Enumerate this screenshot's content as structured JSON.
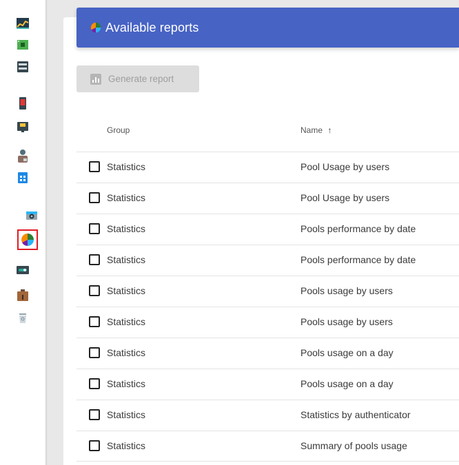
{
  "sidebar": {
    "items": [
      {
        "icon": "chart-graph-icon",
        "active": false
      },
      {
        "icon": "chip-icon",
        "active": false
      },
      {
        "icon": "server-icon",
        "active": false
      },
      {
        "icon": "phone-icon",
        "active": false
      },
      {
        "icon": "network-card-icon",
        "active": false
      },
      {
        "icon": "user-briefcase-icon",
        "active": false
      },
      {
        "icon": "calendar-grid-icon",
        "active": false
      },
      {
        "icon": "camera-icon",
        "active": false
      },
      {
        "icon": "pie-chart-icon",
        "active": true
      },
      {
        "icon": "toggle-switch-icon",
        "active": false
      },
      {
        "icon": "briefcase-icon",
        "active": false
      },
      {
        "icon": "recycle-bin-icon",
        "active": false
      }
    ]
  },
  "header": {
    "title": "Available reports",
    "icon": "pie-chart-icon",
    "color": "#4763c4"
  },
  "toolbar": {
    "generate_label": "Generate report",
    "generate_icon": "bar-chart-icon"
  },
  "table": {
    "columns": {
      "group": "Group",
      "name": "Name",
      "sort_indicator": "↑"
    },
    "rows": [
      {
        "group": "Statistics",
        "name": "Pool Usage by users"
      },
      {
        "group": "Statistics",
        "name": "Pool Usage by users"
      },
      {
        "group": "Statistics",
        "name": "Pools performance by date"
      },
      {
        "group": "Statistics",
        "name": "Pools performance by date"
      },
      {
        "group": "Statistics",
        "name": "Pools usage by users"
      },
      {
        "group": "Statistics",
        "name": "Pools usage by users"
      },
      {
        "group": "Statistics",
        "name": "Pools usage on a day"
      },
      {
        "group": "Statistics",
        "name": "Pools usage on a day"
      },
      {
        "group": "Statistics",
        "name": "Statistics by authenticator"
      },
      {
        "group": "Statistics",
        "name": "Summary of pools usage"
      }
    ]
  }
}
